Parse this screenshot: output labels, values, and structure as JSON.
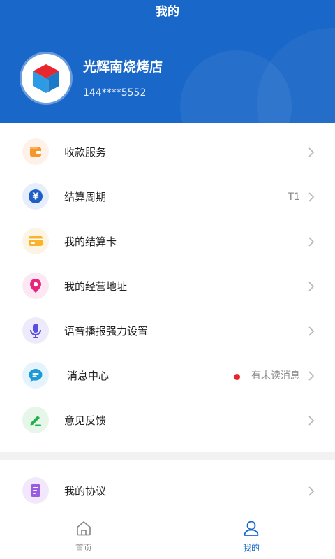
{
  "header": {
    "title": "我的",
    "store_name": "光辉南烧烤店",
    "phone": "144****5552",
    "bg_color": "#1967c8"
  },
  "menu": {
    "items": [
      {
        "icon": "wallet-icon",
        "label": "收款服务",
        "value": ""
      },
      {
        "icon": "yuan-icon",
        "label": "结算周期",
        "value": "T1"
      },
      {
        "icon": "card-icon",
        "label": "我的结算卡",
        "value": ""
      },
      {
        "icon": "location-pin-icon",
        "label": "我的经营地址",
        "value": ""
      },
      {
        "icon": "microphone-icon",
        "label": "语音播报强力设置",
        "value": ""
      },
      {
        "icon": "message-icon",
        "label": "消息中心",
        "value": "有未读消息"
      },
      {
        "icon": "feedback-icon",
        "label": "意见反馈",
        "value": ""
      }
    ],
    "agreement": {
      "icon": "document-icon",
      "label": "我的协议"
    }
  },
  "tabbar": {
    "tabs": [
      {
        "icon": "home-icon",
        "label": "首页",
        "active": false
      },
      {
        "icon": "user-icon",
        "label": "我的",
        "active": true
      }
    ],
    "active_color": "#1967c8",
    "inactive_color": "#8a8a8a"
  },
  "colors": {
    "unread_dot": "#e8232a"
  }
}
